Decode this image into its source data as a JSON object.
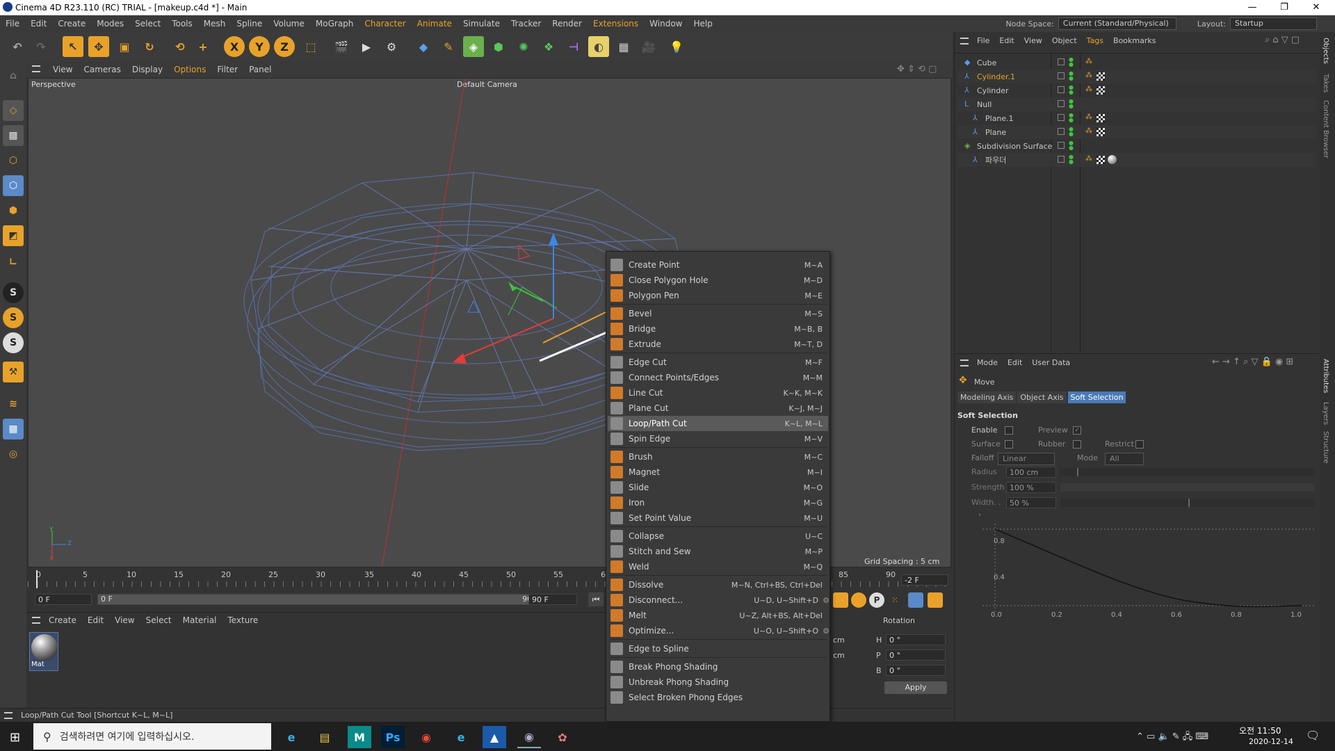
{
  "app": {
    "title": "Cinema 4D R23.110 (RC) TRIAL - [makeup.c4d *] - Main",
    "node_space_label": "Node Space:",
    "node_space_value": "Current (Standard/Physical)",
    "layout_label": "Layout:",
    "layout_value": "Startup"
  },
  "menubar": [
    "File",
    "Edit",
    "Create",
    "Modes",
    "Select",
    "Tools",
    "Mesh",
    "Spline",
    "Volume",
    "MoGraph",
    "Character",
    "Animate",
    "Simulate",
    "Tracker",
    "Render",
    "Extensions",
    "Window",
    "Help"
  ],
  "viewport": {
    "menu": [
      "View",
      "Cameras",
      "Display",
      "Options",
      "Filter",
      "Panel"
    ],
    "perspective_label": "Perspective",
    "camera_label": "Default Camera",
    "grid_spacing": "Grid Spacing : 5 cm",
    "axis_y": "Y",
    "axis_z": "Z",
    "axis_x": "X"
  },
  "timeline": {
    "ticks": [
      "0",
      "5",
      "10",
      "15",
      "20",
      "25",
      "30",
      "35",
      "40",
      "45",
      "50",
      "55",
      "6",
      "85",
      "90"
    ],
    "current_frame": "0 F",
    "start_frame": "0 F",
    "range_end": "90 F",
    "end_frame": "90 F",
    "frame_field": "-2 F"
  },
  "material_manager": {
    "menu": [
      "Create",
      "Edit",
      "View",
      "Select",
      "Material",
      "Texture"
    ],
    "material_name": "Mat"
  },
  "coordinates": {
    "rotation_header": "Rotation",
    "unit": "cm",
    "h_label": "H",
    "h_value": "0 °",
    "p_label": "P",
    "p_value": "0 °",
    "b_label": "B",
    "b_value": "0 °",
    "apply_label": "Apply"
  },
  "status_bar": "Loop/Path Cut Tool [Shortcut K~L, M~L]",
  "object_manager": {
    "menu": [
      "File",
      "Edit",
      "View",
      "Object",
      "Tags",
      "Bookmarks"
    ],
    "objects": [
      {
        "name": "Cube",
        "color": "#c8c8c8"
      },
      {
        "name": "Cylinder.1",
        "color": "#e8a22a"
      },
      {
        "name": "Cylinder",
        "color": "#c8c8c8"
      },
      {
        "name": "Null",
        "color": "#c8c8c8"
      },
      {
        "name": "Plane.1",
        "color": "#c8c8c8"
      },
      {
        "name": "Plane",
        "color": "#c8c8c8"
      },
      {
        "name": "Subdivision Surface",
        "color": "#c8c8c8"
      },
      {
        "name": "파우더",
        "color": "#c8c8c8"
      }
    ]
  },
  "attribute_manager": {
    "menu": [
      "Mode",
      "Edit",
      "User Data"
    ],
    "tool_name": "Move",
    "tabs": [
      "Modeling Axis",
      "Object Axis",
      "Soft Selection"
    ],
    "section_title": "Soft Selection",
    "enable_label": "Enable",
    "preview_label": "Preview",
    "surface_label": "Surface",
    "rubber_label": "Rubber",
    "restrict_label": "Restrict",
    "falloff_label": "Falloff",
    "falloff_value": "Linear",
    "mode_label": "Mode",
    "mode_value": "All",
    "radius_label": "Radius",
    "radius_value": "100 cm",
    "strength_label": "Strength",
    "strength_value": "100 %",
    "width_label": "Width. .",
    "width_value": "50 %",
    "graph_y_labels": [
      "0.8",
      "0.4"
    ],
    "graph_x_labels": [
      "0.0",
      "0.2",
      "0.4",
      "0.6",
      "0.8",
      "1.0"
    ]
  },
  "right_tabs": [
    "Objects",
    "Takes",
    "Content Browser",
    "Attributes",
    "Layers",
    "Structure"
  ],
  "context_menu": [
    {
      "label": "Create Point",
      "shortcut": "M~A",
      "color": "#8a8a8a"
    },
    {
      "label": "Close Polygon Hole",
      "shortcut": "M~D",
      "color": "#d07a2a"
    },
    {
      "label": "Polygon Pen",
      "shortcut": "M~E",
      "color": "#d07a2a"
    },
    {
      "sep": true
    },
    {
      "label": "Bevel",
      "shortcut": "M~S",
      "color": "#d07a2a"
    },
    {
      "label": "Bridge",
      "shortcut": "M~B, B",
      "color": "#d07a2a"
    },
    {
      "label": "Extrude",
      "shortcut": "M~T, D",
      "color": "#d07a2a"
    },
    {
      "sep": true
    },
    {
      "label": "Edge Cut",
      "shortcut": "M~F",
      "color": "#8a8a8a"
    },
    {
      "label": "Connect Points/Edges",
      "shortcut": "M~M",
      "color": "#8a8a8a"
    },
    {
      "label": "Line Cut",
      "shortcut": "K~K, M~K",
      "color": "#d07a2a"
    },
    {
      "label": "Plane Cut",
      "shortcut": "K~J, M~J",
      "color": "#8a8a8a"
    },
    {
      "label": "Loop/Path Cut",
      "shortcut": "K~L, M~L",
      "color": "#8a8a8a",
      "selected": true
    },
    {
      "label": "Spin Edge",
      "shortcut": "M~V",
      "color": "#8a8a8a"
    },
    {
      "sep": true
    },
    {
      "label": "Brush",
      "shortcut": "M~C",
      "color": "#d07a2a"
    },
    {
      "label": "Magnet",
      "shortcut": "M~I",
      "color": "#d07a2a"
    },
    {
      "label": "Slide",
      "shortcut": "M~O",
      "color": "#8a8a8a"
    },
    {
      "label": "Iron",
      "shortcut": "M~G",
      "color": "#d07a2a"
    },
    {
      "label": "Set Point Value",
      "shortcut": "M~U",
      "color": "#8a8a8a"
    },
    {
      "sep": true
    },
    {
      "label": "Collapse",
      "shortcut": "U~C",
      "color": "#8a8a8a"
    },
    {
      "label": "Stitch and Sew",
      "shortcut": "M~P",
      "color": "#8a8a8a"
    },
    {
      "label": "Weld",
      "shortcut": "M~Q",
      "color": "#d07a2a"
    },
    {
      "sep": true
    },
    {
      "label": "Dissolve",
      "shortcut": "M~N, Ctrl+BS, Ctrl+Del",
      "color": "#d07a2a"
    },
    {
      "label": "Disconnect...",
      "shortcut": "U~D, U~Shift+D",
      "color": "#d07a2a",
      "gear": true
    },
    {
      "label": "Melt",
      "shortcut": "U~Z, Alt+BS, Alt+Del",
      "color": "#d07a2a"
    },
    {
      "label": "Optimize...",
      "shortcut": "U~O, U~Shift+O",
      "color": "#d07a2a",
      "gear": true
    },
    {
      "sep": true
    },
    {
      "label": "Edge to Spline",
      "shortcut": "",
      "color": "#8a8a8a"
    },
    {
      "sep": true
    },
    {
      "label": "Break Phong Shading",
      "shortcut": "",
      "color": "#8a8a8a"
    },
    {
      "label": "Unbreak Phong Shading",
      "shortcut": "",
      "color": "#8a8a8a"
    },
    {
      "label": "Select Broken Phong Edges",
      "shortcut": "",
      "color": "#8a8a8a"
    }
  ],
  "taskbar": {
    "search_placeholder": "검색하려면 여기에 입력하십시오.",
    "time": "오전 11:50",
    "date": "2020-12-14"
  }
}
